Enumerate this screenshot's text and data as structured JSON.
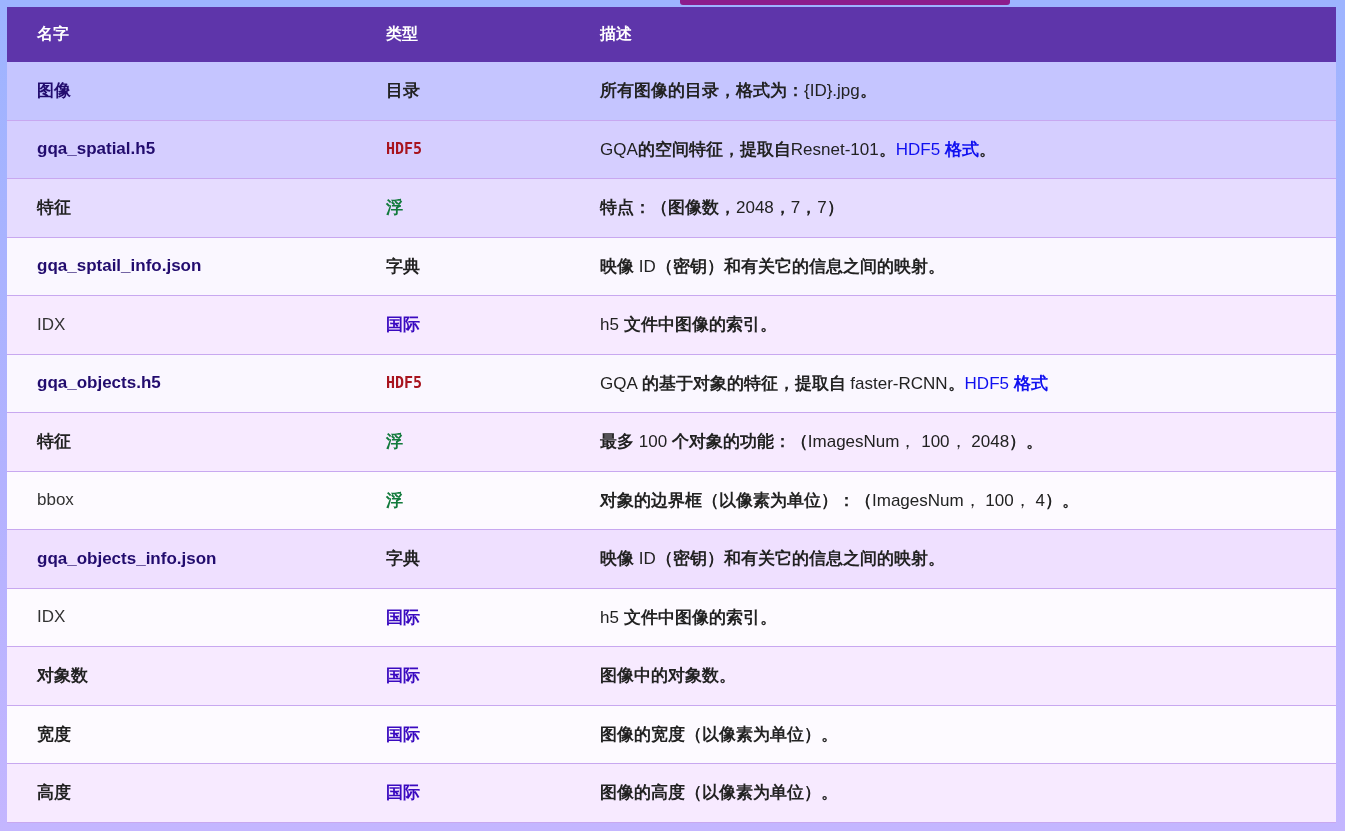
{
  "columns": [
    "名字",
    "类型",
    "描述"
  ],
  "rows": [
    {
      "name": {
        "text": "图像",
        "kind": "file"
      },
      "type": {
        "text": "目录",
        "kind": "dir"
      },
      "color": "#c5c5ff",
      "description": "**所有图像的目录，格式为：**{ID}.jpg**。**"
    },
    {
      "name": {
        "text": "gqa_spatial.h5",
        "kind": "file"
      },
      "type": {
        "text": "HDF5",
        "kind": "hdf5"
      },
      "color": "#d5ceff",
      "description": "GQA**的空间特征，提取自**Resnet-101**。**",
      "link": "HDF5 **格式**",
      "after": "**。**"
    },
    {
      "name": {
        "text": "特征",
        "kind": "field"
      },
      "type": {
        "text": "浮",
        "kind": "float"
      },
      "color": "#e6dcff",
      "description": "**特点：（图像数，**2048**，**7**，**7**）**"
    },
    {
      "name": {
        "text": "gqa_sptail_info.json",
        "kind": "file"
      },
      "type": {
        "text": "字典",
        "kind": "dict"
      },
      "color": "#faf7ff",
      "description": "**映像** ID**（密钥）和有关它的信息之间的映射。**"
    },
    {
      "name": {
        "text": "IDX",
        "kind": "plain"
      },
      "type": {
        "text": "国际",
        "kind": "int"
      },
      "color": "#f7eaff",
      "description": "h5 **文件中图像的索引。**"
    },
    {
      "name": {
        "text": "gqa_objects.h5",
        "kind": "file"
      },
      "type": {
        "text": "HDF5",
        "kind": "hdf5"
      },
      "color": "#faf7ff",
      "description": "GQA **的基于对象的特征，提取自** faster-RCNN**。**",
      "link": "HDF5 **格式**"
    },
    {
      "name": {
        "text": "特征",
        "kind": "field"
      },
      "type": {
        "text": "浮",
        "kind": "float"
      },
      "color": "#f7eaff",
      "description": "**最多** 100 **个对象的功能：（**ImagesNum， 100， 2048**）。**"
    },
    {
      "name": {
        "text": "bbox",
        "kind": "plain"
      },
      "type": {
        "text": "浮",
        "kind": "float"
      },
      "color": "#fdfaff",
      "description": "**对象的边界框（以像素为单位）：（**ImagesNum， 100， 4**）。**"
    },
    {
      "name": {
        "text": "gqa_objects_info.json",
        "kind": "file"
      },
      "type": {
        "text": "字典",
        "kind": "dict"
      },
      "color": "#efe0ff",
      "description": "**映像** ID**（密钥）和有关它的信息之间的映射。**"
    },
    {
      "name": {
        "text": "IDX",
        "kind": "plain"
      },
      "type": {
        "text": "国际",
        "kind": "int"
      },
      "color": "#fdfaff",
      "description": "h5 **文件中图像的索引。**"
    },
    {
      "name": {
        "text": "对象数",
        "kind": "field"
      },
      "type": {
        "text": "国际",
        "kind": "int"
      },
      "color": "#f7eaff",
      "description": "**图像中的对象数。**"
    },
    {
      "name": {
        "text": "宽度",
        "kind": "field"
      },
      "type": {
        "text": "国际",
        "kind": "int"
      },
      "color": "#fdfaff",
      "description": "**图像的宽度（以像素为单位）。**"
    },
    {
      "name": {
        "text": "高度",
        "kind": "field"
      },
      "type": {
        "text": "国际",
        "kind": "int"
      },
      "color": "#f7eaff",
      "description": "**图像的高度（以像素为单位）。**"
    }
  ]
}
